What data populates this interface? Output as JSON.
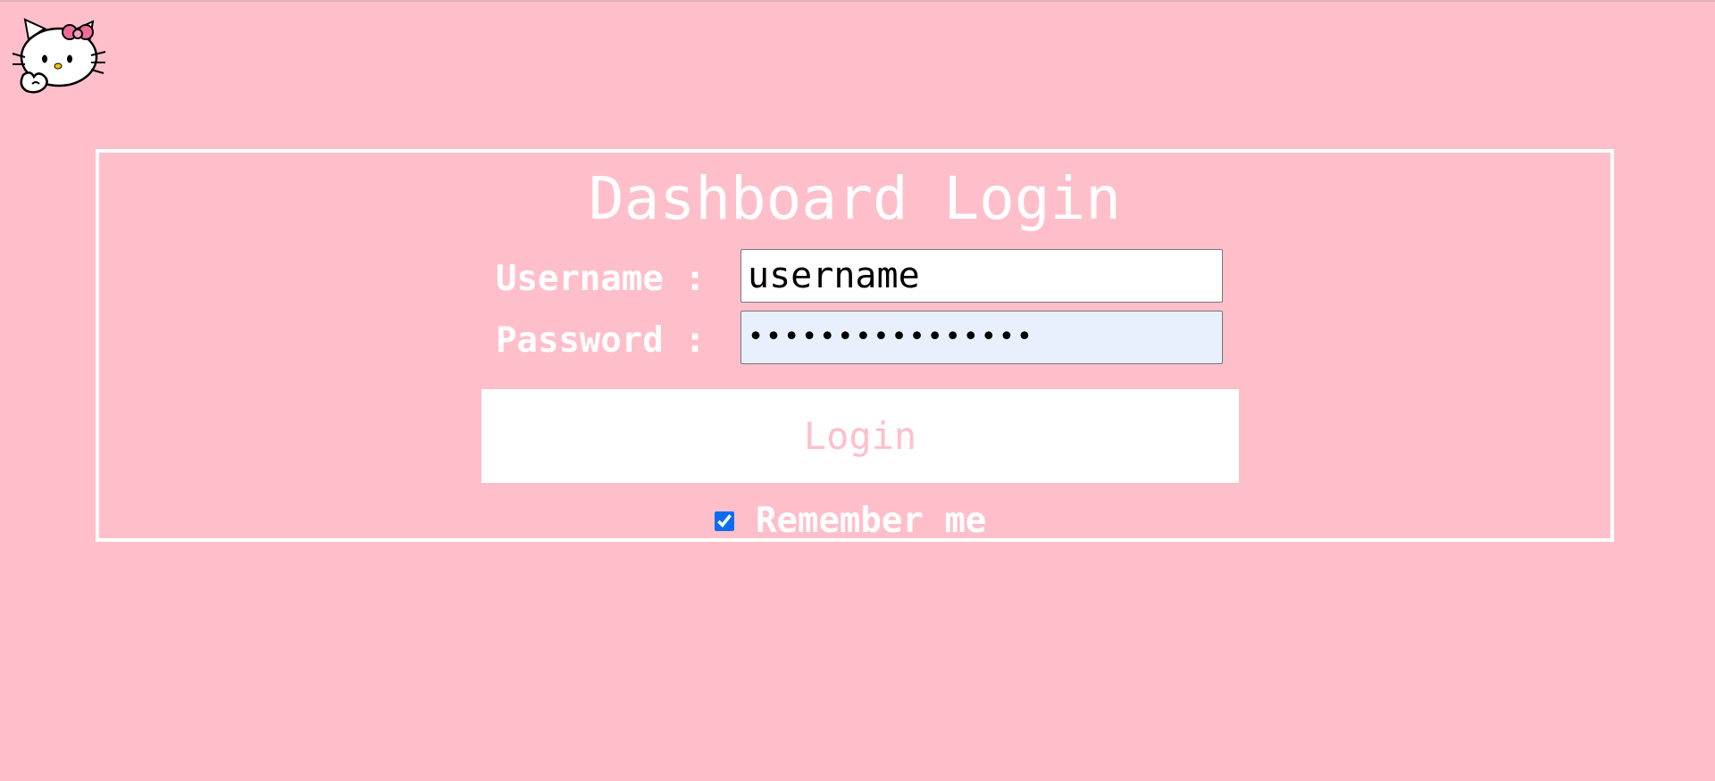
{
  "logo": {
    "icon": "hello-kitty-icon"
  },
  "login": {
    "title": "Dashboard Login",
    "username_label": "Username :",
    "password_label": "Password :",
    "username_value": "username",
    "password_masked": "••••••••••••••••",
    "button_label": "Login",
    "remember_label": "Remember me",
    "remember_checked": true
  },
  "colors": {
    "background": "#ffbfca",
    "accent": "#ffffff",
    "password_fill": "#e8f0fe",
    "checkbox": "#0b6cf2"
  }
}
